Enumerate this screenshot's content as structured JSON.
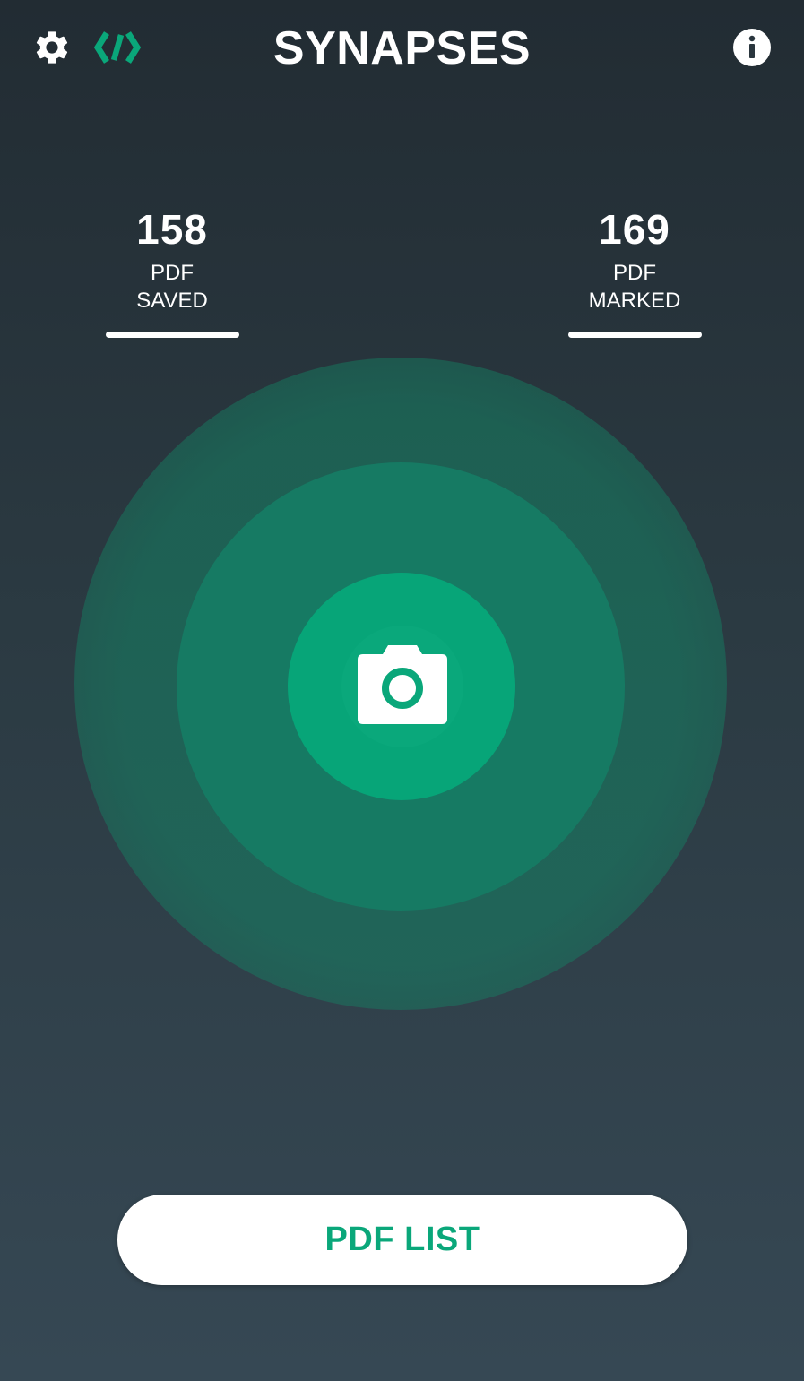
{
  "app": {
    "title": "SYNAPSES"
  },
  "header": {
    "settings_icon": "gear-icon",
    "code_icon": "code-brackets-icon",
    "info_icon": "info-icon"
  },
  "stats": {
    "saved": {
      "value": "158",
      "label": "PDF\nSAVED"
    },
    "marked": {
      "value": "169",
      "label": "PDF\nMARKED"
    }
  },
  "capture": {
    "icon": "camera-icon"
  },
  "actions": {
    "pdf_list_label": "PDF LIST"
  },
  "colors": {
    "accent": "#0aa77a",
    "ring_middle": "#167a63",
    "ring_inner": "#07a578",
    "background_top": "#222c33",
    "background_bottom": "#364854",
    "text": "#ffffff"
  }
}
